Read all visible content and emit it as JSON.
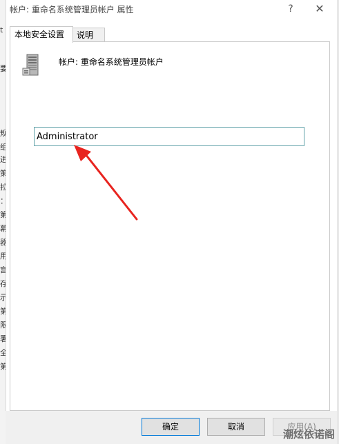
{
  "window": {
    "title": "帐户: 重命名系统管理员帐户 属性",
    "help_glyph": "?",
    "close_glyph": "✕"
  },
  "tabs": [
    {
      "label": "本地安全设置",
      "active": true
    },
    {
      "label": "说明",
      "active": false
    }
  ],
  "panel": {
    "icon": "server-icon",
    "account_label": "帐户: 重命名系统管理员帐户",
    "name_value": "Administrator"
  },
  "buttons": {
    "ok": "确定",
    "cancel": "取消",
    "apply": "应用(A)"
  },
  "watermark": "潮炫依诺阁",
  "annotation": {
    "arrow_color": "#e8241f"
  },
  "background_glyphs": [
    "t",
    "要",
    "规",
    "组",
    "进",
    "策",
    "拉",
    "：",
    "第",
    "幕",
    "器",
    "用",
    "宫",
    "存",
    "示",
    "第",
    "限",
    "署",
    "全",
    "第"
  ]
}
